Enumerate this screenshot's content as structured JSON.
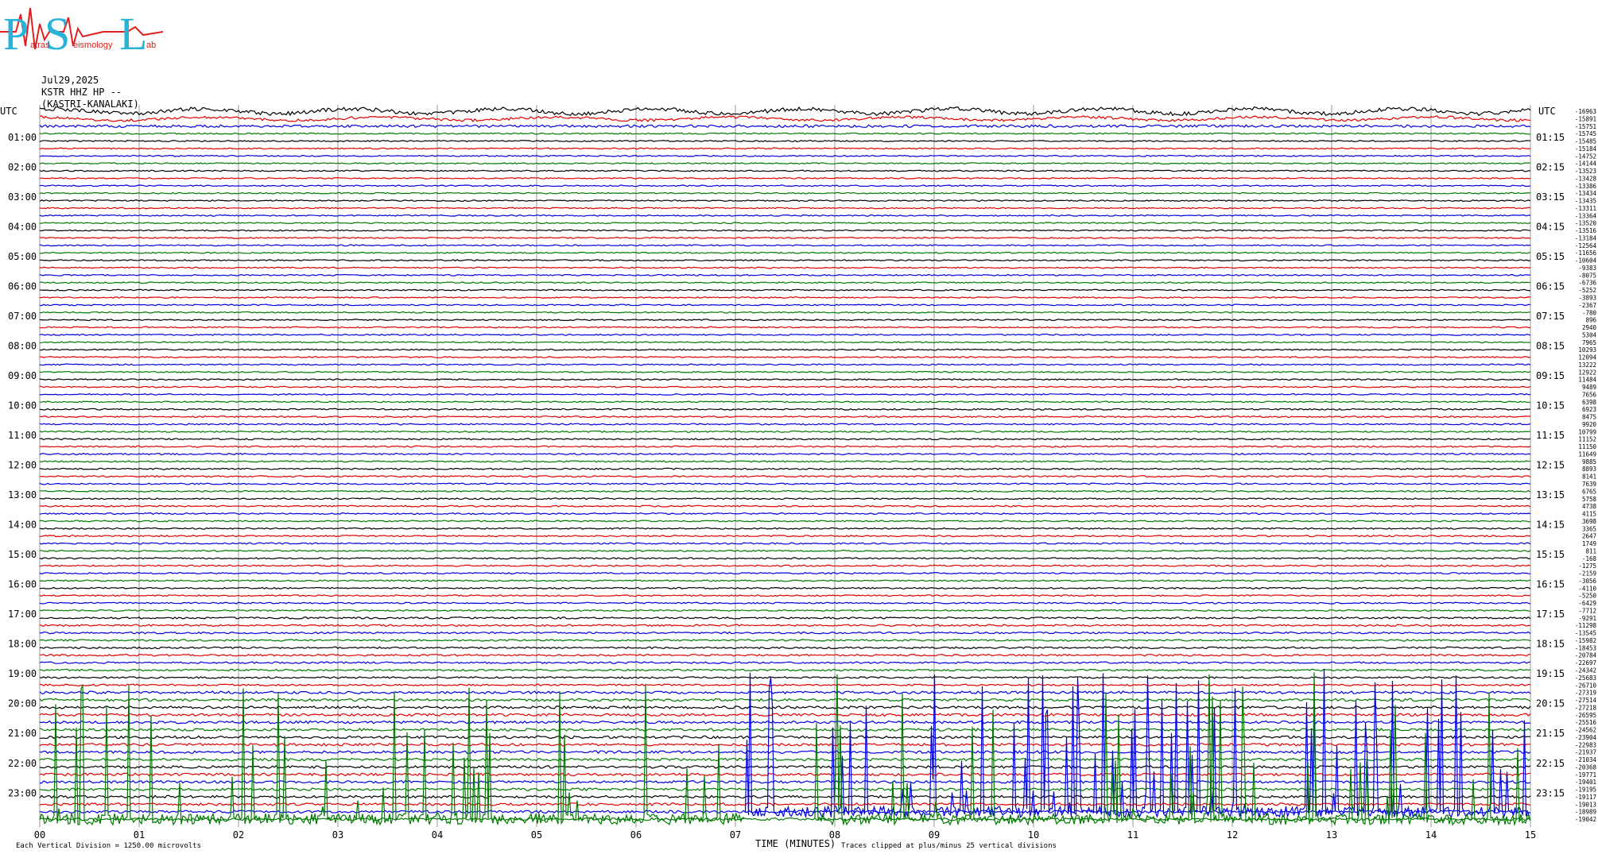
{
  "logo": {
    "big_letters": [
      "P",
      "S",
      "L"
    ],
    "small_words": [
      "atras",
      "eismology",
      "ab"
    ]
  },
  "header": {
    "date": "Jul29,2025",
    "station": "KSTR HHZ HP --",
    "site": "(KASTRI-KANALAKI)"
  },
  "utc_label": "UTC",
  "left_hour_labels": [
    "01:00",
    "02:00",
    "03:00",
    "04:00",
    "05:00",
    "06:00",
    "07:00",
    "08:00",
    "09:00",
    "10:00",
    "11:00",
    "12:00",
    "13:00",
    "14:00",
    "15:00",
    "16:00",
    "17:00",
    "18:00",
    "19:00",
    "20:00",
    "21:00",
    "22:00",
    "23:00"
  ],
  "right_hour_labels": [
    "01:15",
    "02:15",
    "03:15",
    "04:15",
    "05:15",
    "06:15",
    "07:15",
    "08:15",
    "09:15",
    "10:15",
    "11:15",
    "12:15",
    "13:15",
    "14:15",
    "15:15",
    "16:15",
    "17:15",
    "18:15",
    "19:15",
    "20:15",
    "21:15",
    "22:15",
    "23:15"
  ],
  "x_tick_labels": [
    "00",
    "01",
    "02",
    "03",
    "04",
    "05",
    "06",
    "07",
    "08",
    "09",
    "10",
    "11",
    "12",
    "13",
    "14",
    "15"
  ],
  "x_axis_title": "TIME (MINUTES)",
  "footer_left": "Each Vertical Division = 1250.00 microvolts",
  "footer_right": "Traces clipped at plus/minus 25 vertical divisions",
  "colors": {
    "trace_cycle": [
      "#000000",
      "#e00000",
      "#0000e0",
      "#007a00"
    ],
    "grid": "#999999"
  },
  "chart_data": {
    "type": "line",
    "title": "",
    "xlabel": "TIME (MINUTES)",
    "x_range": [
      0,
      15
    ],
    "trace_count": 96,
    "minutes_per_trace": 15,
    "trace_offsets": [
      -16963,
      -15891,
      -15751,
      -15745,
      -15485,
      -15184,
      -14752,
      -14144,
      -13523,
      -13428,
      -13386,
      -13434,
      -13435,
      -13311,
      -13364,
      -13520,
      -13516,
      -13184,
      -12564,
      -11656,
      -10604,
      -9383,
      -8075,
      -6736,
      -5252,
      -3893,
      -2367,
      -780,
      896,
      2940,
      5304,
      7965,
      10293,
      12094,
      13222,
      12922,
      11484,
      9489,
      7656,
      6398,
      6923,
      8475,
      9920,
      10799,
      11152,
      11150,
      11649,
      9885,
      8893,
      8141,
      7639,
      6765,
      5758,
      4738,
      4115,
      3698,
      3365,
      2647,
      1749,
      811,
      -168,
      -1275,
      -2159,
      -3056,
      -4110,
      -5250,
      -6429,
      -7712,
      -9291,
      -11298,
      -13545,
      -15982,
      -18453,
      -20784,
      -22697,
      -24342,
      -25683,
      -26710,
      -27319,
      -27514,
      -27218,
      -26595,
      -25516,
      -24562,
      -23904,
      -22983,
      -21937,
      -21034,
      -20368,
      -19771,
      -19401,
      -19195,
      -19117,
      -19013,
      -18989,
      -19042
    ],
    "activity_note": "Traces clipped at plus/minus 25 vertical divisions",
    "grid": true
  }
}
